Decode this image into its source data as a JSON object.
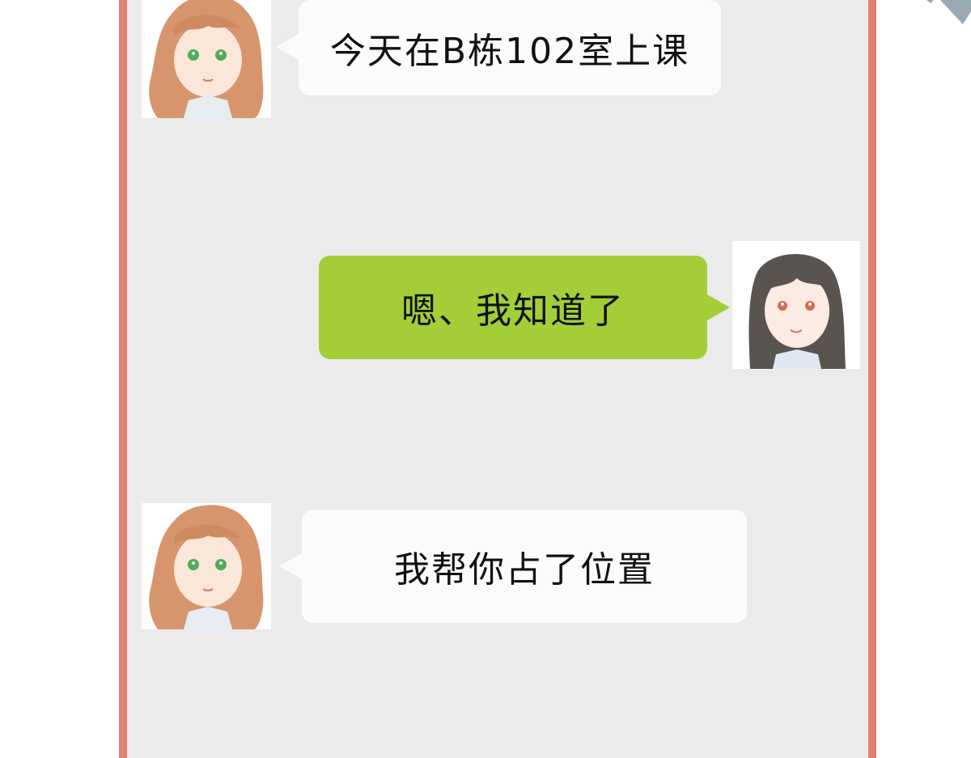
{
  "colors": {
    "frame": "#e0826e",
    "chat_background": "#ebebeb",
    "incoming_bubble": "#fbfbfb",
    "outgoing_bubble": "#a3ce38"
  },
  "messages": [
    {
      "sender": "friend",
      "side": "left",
      "avatar": "brown-haired-girl-avatar",
      "text": "今天在B栋102室上课"
    },
    {
      "sender": "me",
      "side": "right",
      "avatar": "dark-haired-girl-avatar",
      "text": "嗯、我知道了"
    },
    {
      "sender": "friend",
      "side": "left",
      "avatar": "brown-haired-girl-avatar",
      "text": "我帮你占了位置"
    }
  ]
}
